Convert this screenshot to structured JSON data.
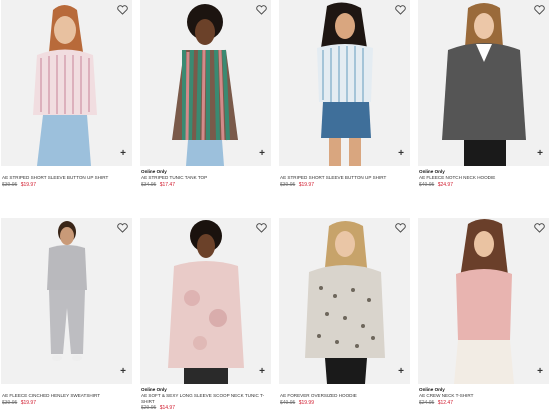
{
  "products": [
    {
      "badge": "",
      "name": "AE Striped Short Sleeve Button Up Shirt",
      "original_price": "$39.95",
      "sale_price": "$19.97"
    },
    {
      "badge": "Online Only",
      "name": "AE Striped Tunic Tank Top",
      "original_price": "$34.95",
      "sale_price": "$17.47"
    },
    {
      "badge": "",
      "name": "AE Striped Short Sleeve Button Up Shirt",
      "original_price": "$39.95",
      "sale_price": "$19.97"
    },
    {
      "badge": "Online Only",
      "name": "AE Fleece Notch Neck Hoodie",
      "original_price": "$49.95",
      "sale_price": "$24.97"
    },
    {
      "badge": "",
      "name": "AE Fleece Cinched Henley Sweatshirt",
      "original_price": "$39.95",
      "sale_price": "$19.97"
    },
    {
      "badge": "Online Only",
      "name": "AE Soft & Sexy Long Sleeve Scoop Neck Tunic T-Shirt",
      "original_price": "$29.95",
      "sale_price": "$14.97"
    },
    {
      "badge": "",
      "name": "AE Forever Oversized Hoodie",
      "original_price": "$49.95",
      "sale_price": "$19.99"
    },
    {
      "badge": "Online Only",
      "name": "AE Crew Neck T-Shirt",
      "original_price": "$24.95",
      "sale_price": "$12.47"
    }
  ],
  "icons": {
    "favorite": "heart-outline-icon",
    "add": "plus-icon"
  },
  "colors": {
    "sale": "#d0192c",
    "original": "#777777"
  }
}
